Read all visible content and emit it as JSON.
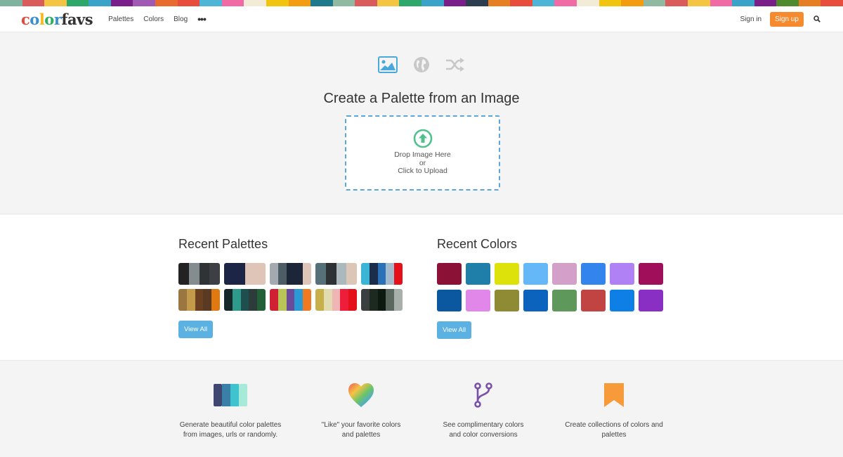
{
  "stripe_colors": [
    "#7fb3a0",
    "#d95b5b",
    "#f4c542",
    "#2ea76b",
    "#3aa3c9",
    "#7a1f8a",
    "#a15ab3",
    "#e86a2e",
    "#e74c3c",
    "#4fb5d6",
    "#f06aa6",
    "#f3ead8",
    "#f1c40f",
    "#f39c12",
    "#1c7a8c",
    "#8fb9a0",
    "#d95b5b",
    "#f4c542",
    "#2ea76b",
    "#3aa3c9",
    "#7a1f8a",
    "#2c3e50",
    "#e67e22",
    "#e74c3c",
    "#4fb5d6",
    "#f06aa6",
    "#f3ead8",
    "#f1c40f",
    "#f39c12",
    "#8fb9a0",
    "#d95b5b",
    "#f4c542",
    "#f06aa6",
    "#3aa3c9",
    "#7a1f8a",
    "#4e8a2e",
    "#e67e22",
    "#e74c3c"
  ],
  "nav": {
    "logo": {
      "text": "colorfavs",
      "letters": [
        {
          "ch": "c",
          "color": "#e24a3b"
        },
        {
          "ch": "o",
          "color": "#3a8fd1"
        },
        {
          "ch": "l",
          "color": "#f4b81c"
        },
        {
          "ch": "o",
          "color": "#2fae5f"
        },
        {
          "ch": "r",
          "color": "#3a8fd1"
        },
        {
          "ch": "f",
          "color": "#333333"
        },
        {
          "ch": "a",
          "color": "#333333"
        },
        {
          "ch": "v",
          "color": "#333333"
        },
        {
          "ch": "s",
          "color": "#333333"
        }
      ]
    },
    "links": [
      "Palettes",
      "Colors",
      "Blog"
    ],
    "more_label": "•••",
    "sign_in": "Sign in",
    "sign_up": "Sign up"
  },
  "hero": {
    "modes": [
      "image-icon",
      "globe-icon",
      "shuffle-icon"
    ],
    "title": "Create a Palette from an Image",
    "drop_line1": "Drop Image Here",
    "drop_line2": "or",
    "drop_line3": "Click to Upload"
  },
  "recent_palettes": {
    "title": "Recent Palettes",
    "view_all": "View All",
    "palettes": [
      [
        "#222222",
        "#858c8f",
        "#2f3336",
        "#3c3f44"
      ],
      [
        "#1d2547",
        "#1d2547",
        "#dfc4b8",
        "#dfc4b8"
      ],
      [
        "#a2aab0",
        "#4d5d66",
        "#1d2538",
        "#1d2538",
        "#dfc4b8"
      ],
      [
        "#56707a",
        "#2e3234",
        "#abb8bd",
        "#dcc6b6"
      ],
      [
        "#3bb4d6",
        "#1b2d4a",
        "#2b71b8",
        "#a3b9cc",
        "#e4101a"
      ],
      [
        "#9a7641",
        "#c39a4a",
        "#6b4020",
        "#5a3a22",
        "#e07a10"
      ],
      [
        "#162828",
        "#2e9a8c",
        "#1f4e4e",
        "#2b3c3a",
        "#236038"
      ],
      [
        "#cf2034",
        "#b8c458",
        "#6a4a9a",
        "#2a9ad6",
        "#f07a22"
      ],
      [
        "#c7b04a",
        "#e2dab0",
        "#f0b4b4",
        "#ee1e3a",
        "#e4101a"
      ],
      [
        "#3b3f40",
        "#1c2a20",
        "#0c1a10",
        "#5a6860",
        "#a8b0ac"
      ]
    ]
  },
  "recent_colors": {
    "title": "Recent Colors",
    "view_all": "View All",
    "colors": [
      "#8b1236",
      "#1f7fa8",
      "#dde20a",
      "#65b8f8",
      "#d2a0c8",
      "#3484ee",
      "#b081f5",
      "#a0105a",
      "#0b58a0",
      "#e287ea",
      "#8e8b34",
      "#0c63bd",
      "#5e985a",
      "#c14443",
      "#0e7fe5",
      "#8a2fc3"
    ]
  },
  "features": [
    {
      "icon": "palette-swatch-icon",
      "line1": "Generate beautiful color palettes",
      "line2": "from images, urls or randomly."
    },
    {
      "icon": "rainbow-heart-icon",
      "line1": "\"Like\" your favorite colors",
      "line2": "and palettes"
    },
    {
      "icon": "branch-icon",
      "line1": "See complimentary colors",
      "line2": "and color conversions"
    },
    {
      "icon": "bookmark-icon",
      "line1": "Create collections of colors and",
      "line2": "palettes"
    }
  ]
}
